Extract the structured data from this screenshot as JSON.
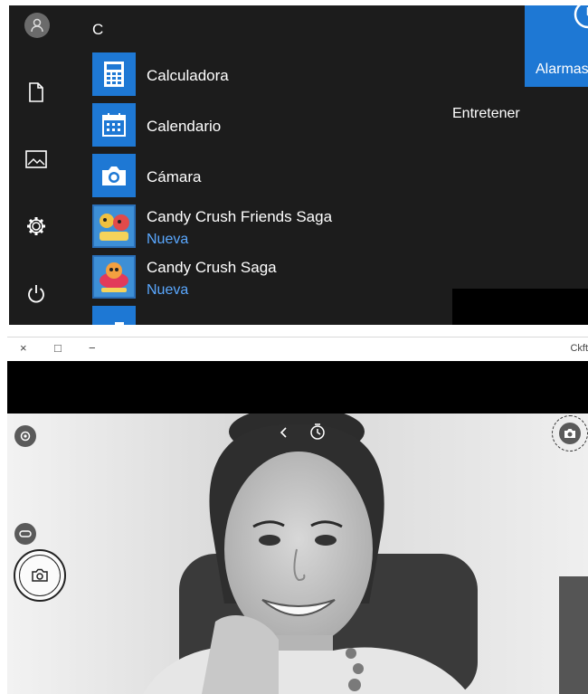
{
  "start_menu": {
    "section_letter": "C",
    "apps": [
      {
        "name": "Calculadora",
        "badge": "",
        "icon": "calculator-icon"
      },
      {
        "name": "Calendario",
        "badge": "",
        "icon": "calendar-icon"
      },
      {
        "name": "Cámara",
        "badge": "",
        "icon": "camera-icon"
      },
      {
        "name": "Candy Crush Friends Saga",
        "badge": "Nueva",
        "icon": "candy-crush-friends-icon"
      },
      {
        "name": "Candy Crush Saga",
        "badge": "Nueva",
        "icon": "candy-crush-icon"
      }
    ],
    "rail_icons": [
      "user-avatar-icon",
      "document-icon",
      "pictures-icon",
      "settings-gear-icon",
      "power-icon"
    ],
    "tiles": {
      "alarm_label": "Alarmas",
      "group_label": "Entretener"
    }
  },
  "camera_window": {
    "titlebar_controls": [
      "×",
      "□",
      "−"
    ],
    "titlebar_right_text": "Ckft",
    "icons": [
      "settings-icon",
      "back-chevron-icon",
      "timer-icon",
      "photo-settings-icon",
      "video-mode-icon",
      "photo-capture-icon"
    ]
  },
  "colors": {
    "start_bg": "#1c1c1c",
    "tile_blue": "#1e78d4",
    "badge_blue": "#5aa8ff"
  }
}
